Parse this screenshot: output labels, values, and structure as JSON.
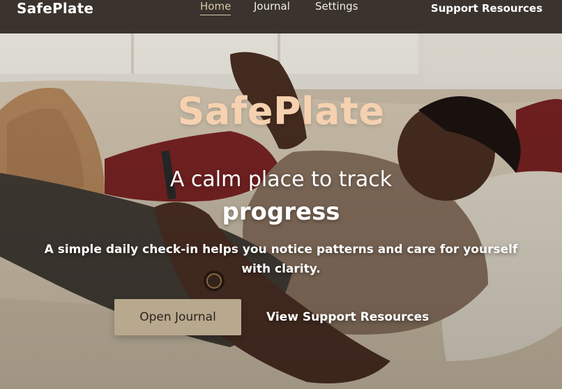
{
  "header": {
    "brand": "SafePlate",
    "nav": {
      "home": "Home",
      "journal": "Journal",
      "settings": "Settings"
    },
    "support": "Support Resources"
  },
  "hero": {
    "title": "SafePlate",
    "subtitle_line1": "A calm place to track",
    "subtitle_line2": "progress",
    "description": "A simple daily check-in helps you notice patterns and care for yourself with clarity.",
    "primary_button": "Open Journal",
    "secondary_link": "View Support Resources"
  },
  "colors": {
    "nav_bg": "#3a332e",
    "title_accent": "#f6d1b0",
    "primary_button_bg": "#b8a88d",
    "active_link": "#d8c9a9"
  }
}
